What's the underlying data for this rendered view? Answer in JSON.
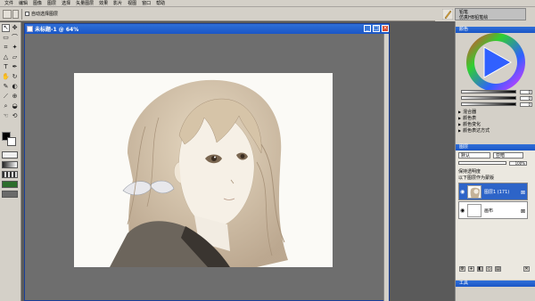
{
  "menubar": [
    "文件",
    "编辑",
    "图像",
    "图层",
    "选择",
    "矢量图层",
    "效果",
    "影片",
    "视图",
    "窗口",
    "帮助"
  ],
  "toolbar": {
    "checkbox_label": "自动选择图层"
  },
  "brush_panel": {
    "line1": "铅笔",
    "line2": "仿真HB铅笔绘"
  },
  "document": {
    "title": "未标题-1 @ 64%"
  },
  "color_panel": {
    "title": "颜色",
    "values": [
      "0",
      "0",
      "0"
    ]
  },
  "panel_menu": [
    "混合器",
    "颜色表",
    "颜色变化",
    "颜色表达方式"
  ],
  "layers_panel": {
    "title": "图层",
    "blend_mode": "默认",
    "opacity_label": "亚暗",
    "opacity_value": "100%",
    "options": [
      "保持透明度",
      "以下图层作为蒙版"
    ],
    "layers": [
      {
        "name": "图层1",
        "extra": "(171)",
        "active": true
      },
      {
        "name": "画布",
        "active": false
      }
    ]
  },
  "bottom_panel": {
    "title": "工具"
  },
  "colors": {
    "accent": "#1a56c6",
    "canvas": "#fbfaf6"
  }
}
